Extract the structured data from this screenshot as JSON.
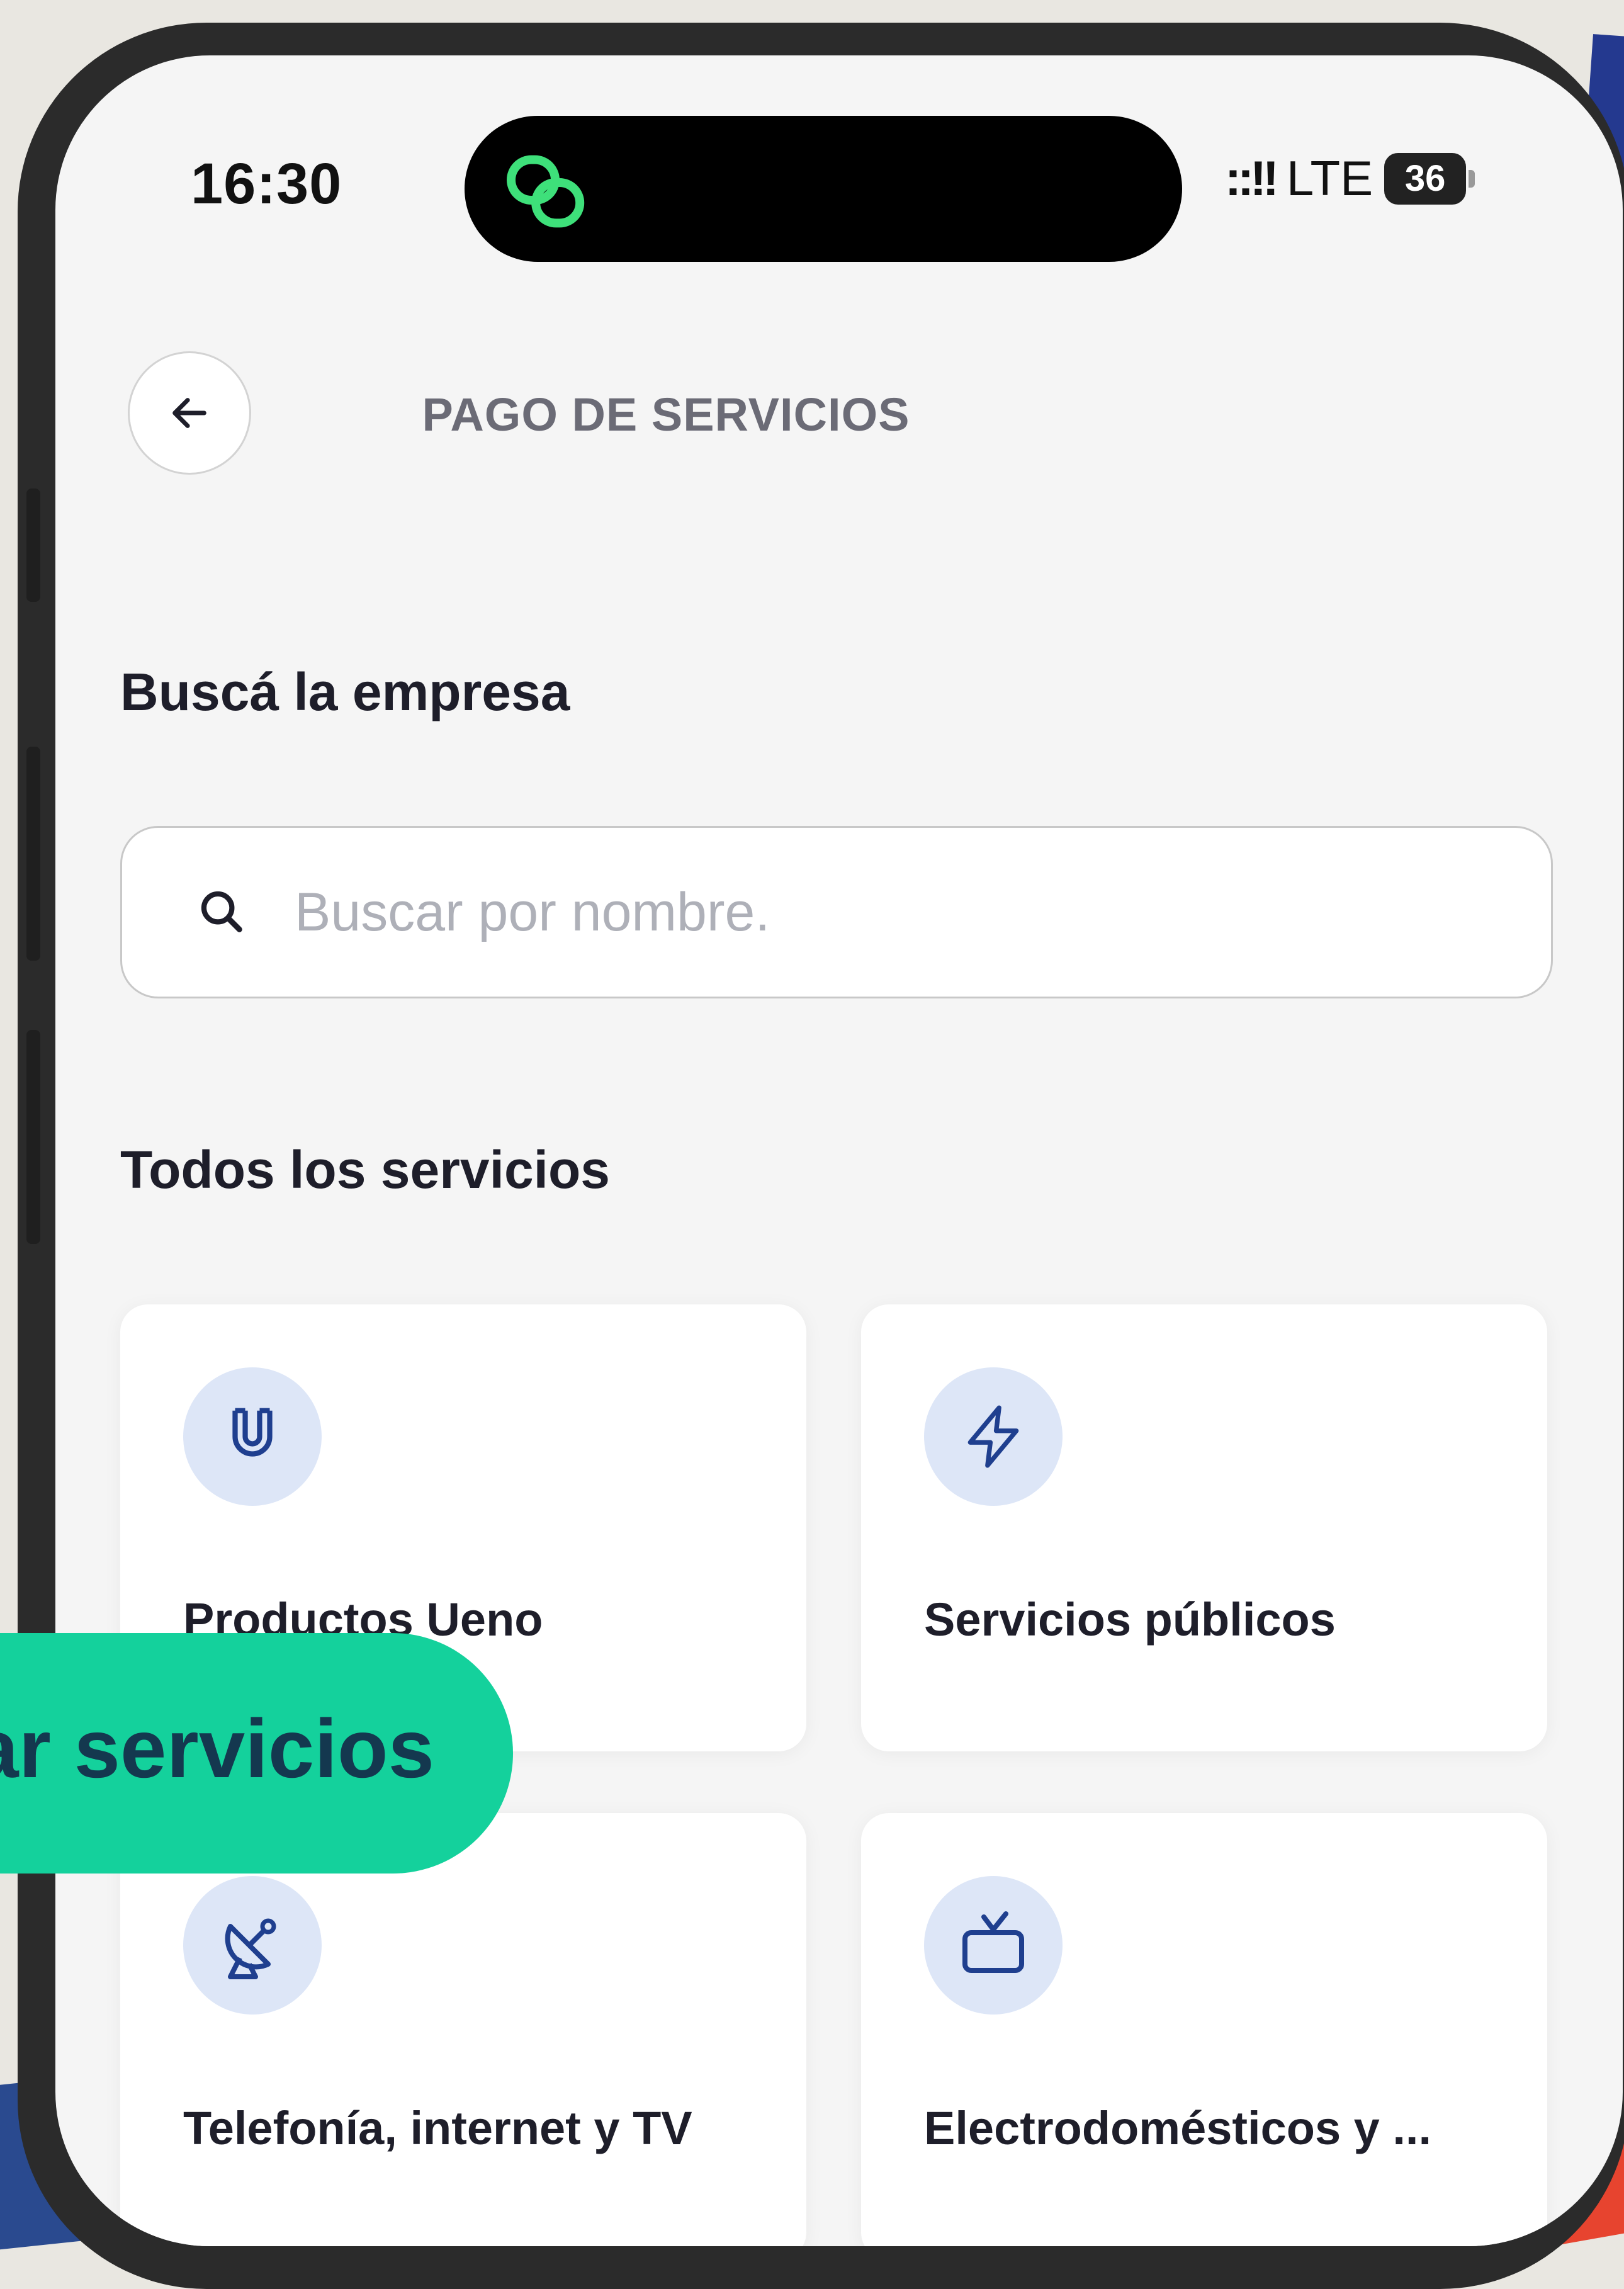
{
  "status_bar": {
    "time": "16:30",
    "signal_icon": "signal-dots-icon",
    "network": "LTE",
    "battery": "36"
  },
  "header": {
    "back_icon": "arrow-left-icon",
    "title": "PAGO DE SERVICIOS"
  },
  "search": {
    "section_title": "Buscá la empresa",
    "placeholder": "Buscar por nombre.",
    "value": ""
  },
  "services": {
    "section_title": "Todos los servicios",
    "items": [
      {
        "label": "Productos Ueno",
        "icon": "u-letter-icon"
      },
      {
        "label": "Servicios públicos",
        "icon": "lightning-bolt-icon"
      },
      {
        "label": "Telefonía, internet y TV",
        "icon": "satellite-dish-icon"
      },
      {
        "label": "Electrodomésticos y ...",
        "icon": "tv-icon"
      }
    ]
  },
  "promo": {
    "text": "gar servicios"
  },
  "colors": {
    "accent": "#14d19c",
    "icon_blue": "#1f3f8f",
    "icon_bg": "#dde6f7",
    "promo_text": "#14384f"
  }
}
